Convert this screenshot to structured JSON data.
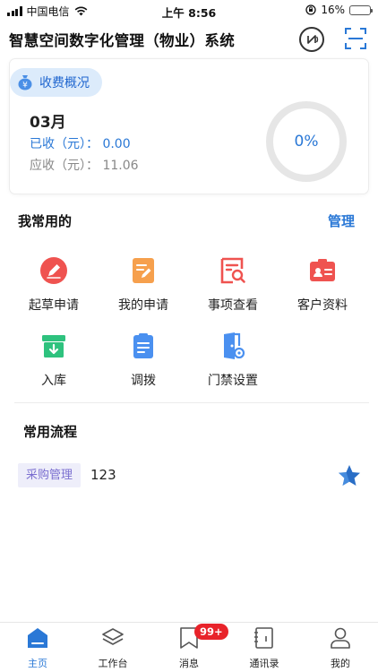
{
  "status_bar": {
    "carrier": "中国电信",
    "time": "上午 8:56",
    "battery": "16%",
    "battery_level": 0.16
  },
  "header": {
    "title": "智慧空间数字化管理（物业）系统",
    "nfc_icon": "nfc-icon",
    "scan_icon": "scan-icon"
  },
  "fee_overview": {
    "tag_label": "收费概况",
    "tag_icon": "coin-bag-icon",
    "month": "03月",
    "received": "已收（元）：  0.00",
    "due": "应收（元）：  11.06",
    "percent_text": "0%",
    "percent_value": 0
  },
  "common": {
    "title": "我常用的",
    "manage_label": "管理",
    "items": [
      {
        "label": "起草申请",
        "icon": "pen-icon"
      },
      {
        "label": "我的申请",
        "icon": "document-edit-icon"
      },
      {
        "label": "事项查看",
        "icon": "search-document-icon"
      },
      {
        "label": "客户资料",
        "icon": "contact-card-icon"
      },
      {
        "label": "入库",
        "icon": "inbox-download-icon"
      },
      {
        "label": "调拨",
        "icon": "transfer-list-icon"
      },
      {
        "label": "门禁设置",
        "icon": "door-settings-icon"
      }
    ]
  },
  "flows": {
    "title": "常用流程",
    "items": [
      {
        "tag": "采购管理",
        "name": "123",
        "icon": "star-icon"
      }
    ]
  },
  "tab_bar": {
    "tabs": [
      {
        "label": "主页",
        "icon": "home-icon",
        "active": true
      },
      {
        "label": "工作台",
        "icon": "layers-icon",
        "active": false
      },
      {
        "label": "消息",
        "icon": "bookmark-message-icon",
        "active": false,
        "badge": "99+"
      },
      {
        "label": "通讯录",
        "icon": "contacts-book-icon",
        "active": false
      },
      {
        "label": "我的",
        "icon": "person-icon",
        "active": false
      }
    ]
  },
  "colors": {
    "primary": "#2a78d6",
    "red_icon": "#ef5350",
    "orange_icon": "#f6a04d",
    "green_icon": "#2ec27e",
    "blue_icon": "#4a90f0",
    "badge": "#e8232a"
  }
}
